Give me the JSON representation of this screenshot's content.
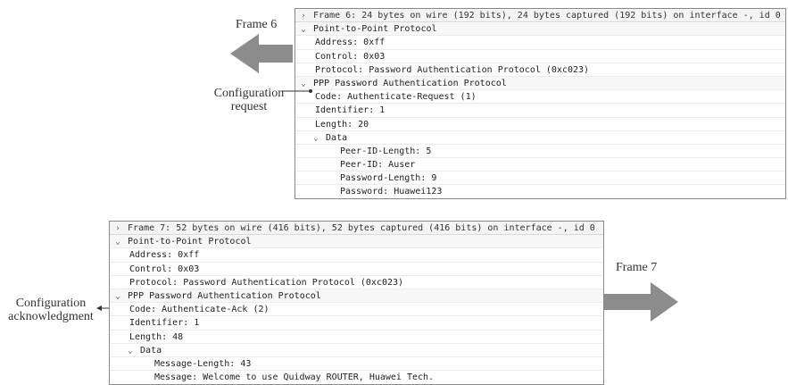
{
  "top_panel": {
    "frame_summary": "Frame 6: 24 bytes on wire (192 bits), 24 bytes captured (192 bits) on interface -, id 0",
    "ppp": {
      "header": "Point-to-Point Protocol",
      "fields": [
        "Address: 0xff",
        "Control: 0x03",
        "Protocol: Password Authentication Protocol (0xc023)"
      ]
    },
    "pap": {
      "header": "PPP Password Authentication Protocol",
      "fields": [
        "Code: Authenticate-Request (1)",
        "Identifier: 1",
        "Length: 20"
      ],
      "data_header": "Data",
      "data_fields": [
        "Peer-ID-Length: 5",
        "Peer-ID: Auser",
        "Password-Length: 9",
        "Password: Huawei123"
      ]
    }
  },
  "bottom_panel": {
    "frame_summary": "Frame 7: 52 bytes on wire (416 bits), 52 bytes captured (416 bits) on interface -, id 0",
    "ppp": {
      "header": "Point-to-Point Protocol",
      "fields": [
        "Address: 0xff",
        "Control: 0x03",
        "Protocol: Password Authentication Protocol (0xc023)"
      ]
    },
    "pap": {
      "header": "PPP Password Authentication Protocol",
      "fields": [
        "Code: Authenticate-Ack (2)",
        "Identifier: 1",
        "Length: 48"
      ],
      "data_header": "Data",
      "data_fields": [
        "Message-Length: 43",
        "Message: Welcome to use Quidway ROUTER, Huawei Tech."
      ]
    }
  },
  "labels": {
    "frame6": "Frame 6",
    "frame7": "Frame 7",
    "config_request": [
      "Configuration",
      "request"
    ],
    "config_ack": [
      "Configuration",
      "acknowledgment"
    ]
  },
  "icons": {
    "collapsed": "›",
    "expanded": "⌄"
  },
  "colors": {
    "arrow_fill": "#8c8c8c",
    "border": "#8a8a8a"
  }
}
